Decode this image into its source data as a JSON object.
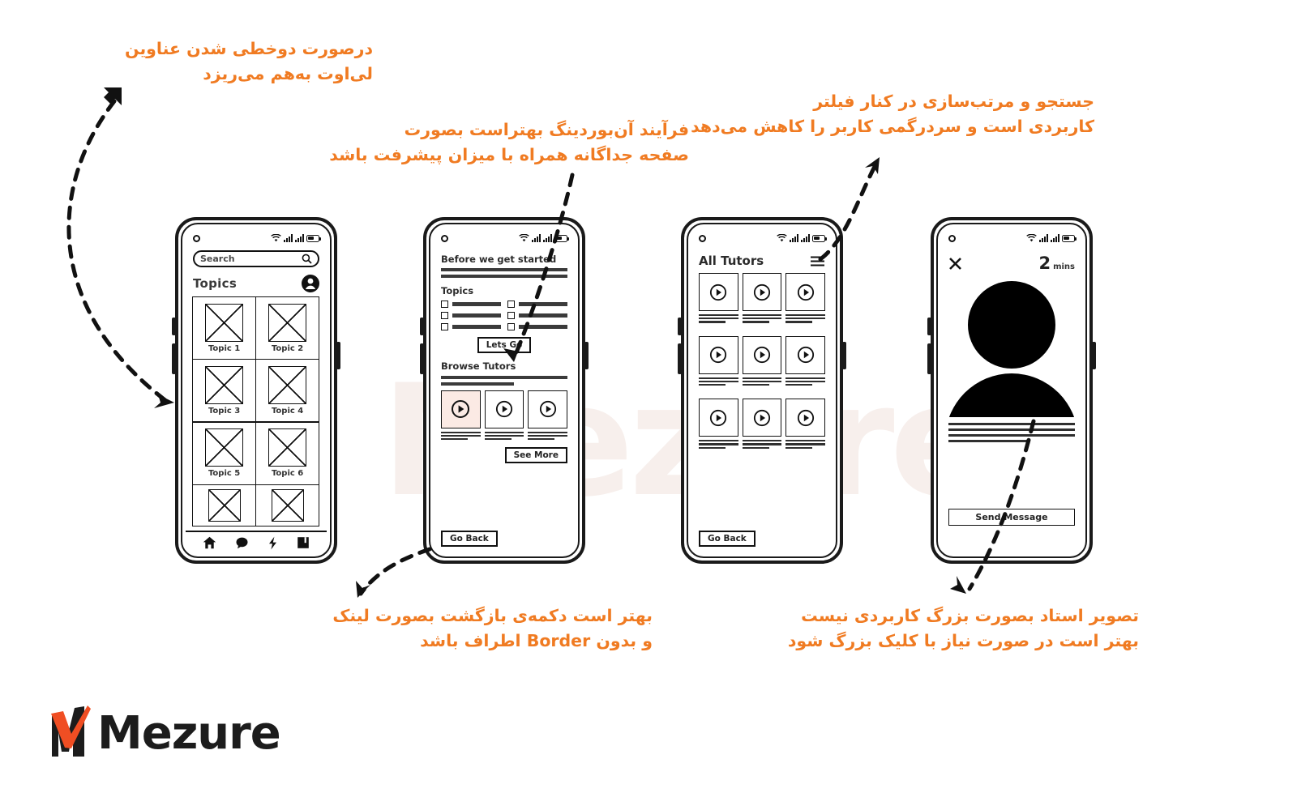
{
  "brand": {
    "logo_text": "Mezure",
    "accent_color": "#F07B22",
    "ink_color": "#1a1a1a",
    "watermark_text": "Mezure"
  },
  "annotations": [
    {
      "id": "annot-1",
      "text": "درصورت دوخطی شدن عناوین\nلی‌اوت به‌هم می‌ریزد",
      "target": "topics-grid-phone-1"
    },
    {
      "id": "annot-2",
      "text": "فرآیند آن‌بوردینگ بهتراست بصورت\nصفحه جداگانه همراه با میزان پیشرفت باشد",
      "target": "lets-go-button-phone-2"
    },
    {
      "id": "annot-3",
      "text": "جستجو و مرتب‌سازی در کنار فیلتر\nکاربردی است و سردرگمی کاربر را کاهش می‌دهد",
      "target": "filter-icon-phone-3"
    },
    {
      "id": "annot-4",
      "text": "بهتر است دکمه‌ی بازگشت بصورت لینک\nو بدون Border اطراف باشد",
      "target": "go-back-button-phone-2"
    },
    {
      "id": "annot-5",
      "text": "تصویر استاد بصورت بزرگ کاربردی نیست\nبهتر است در صورت نیاز با کلیک بزرگ شود",
      "target": "avatar-phone-4"
    }
  ],
  "status_bar": {
    "camera": "front-camera-dot",
    "wifi": "wifi-icon",
    "signal_1": "signal-bars-icon",
    "signal_2": "signal-bars-icon",
    "battery": "battery-icon"
  },
  "phone_1": {
    "name": "topics-home-screen",
    "search": {
      "placeholder": "Search",
      "icon": "search-icon"
    },
    "header": {
      "title": "Topics",
      "avatar_icon": "account-avatar-icon"
    },
    "topics": [
      {
        "label": "Topic 1"
      },
      {
        "label": "Topic 2"
      },
      {
        "label": "Topic 3"
      },
      {
        "label": "Topic 4"
      },
      {
        "label": "Topic 5"
      },
      {
        "label": "Topic 6"
      },
      {
        "label": ""
      },
      {
        "label": ""
      }
    ],
    "bottom_nav": [
      {
        "icon": "home-icon"
      },
      {
        "icon": "chat-bubble-icon"
      },
      {
        "icon": "lightning-bolt-icon"
      },
      {
        "icon": "bookmark-icon"
      }
    ]
  },
  "phone_2": {
    "name": "onboarding-screen",
    "title": "Before we get started",
    "topics_label": "Topics",
    "checkbox_count": 6,
    "lets_go_label": "Lets Go",
    "browse_tutors_label": "Browse Tutors",
    "tutor_cards": [
      {
        "icon": "play-icon",
        "selected": true
      },
      {
        "icon": "play-icon",
        "selected": false
      },
      {
        "icon": "play-icon",
        "selected": false
      }
    ],
    "see_more_label": "See More",
    "go_back_label": "Go Back"
  },
  "phone_3": {
    "name": "all-tutors-screen",
    "title": "All Tutors",
    "filter_icon": "filter-sliders-icon",
    "tutor_rows": [
      [
        {
          "icon": "play-icon"
        },
        {
          "icon": "play-icon"
        },
        {
          "icon": "play-icon"
        }
      ],
      [
        {
          "icon": "play-icon"
        },
        {
          "icon": "play-icon"
        },
        {
          "icon": "play-icon"
        }
      ],
      [
        {
          "icon": "play-icon"
        },
        {
          "icon": "play-icon"
        },
        {
          "icon": "play-icon"
        }
      ]
    ],
    "go_back_label": "Go Back"
  },
  "phone_4": {
    "name": "tutor-profile-screen",
    "close_icon": "close-x-icon",
    "duration_value": "2",
    "duration_unit": "mins",
    "avatar_icon": "large-person-avatar",
    "send_message_label": "Send Message"
  }
}
